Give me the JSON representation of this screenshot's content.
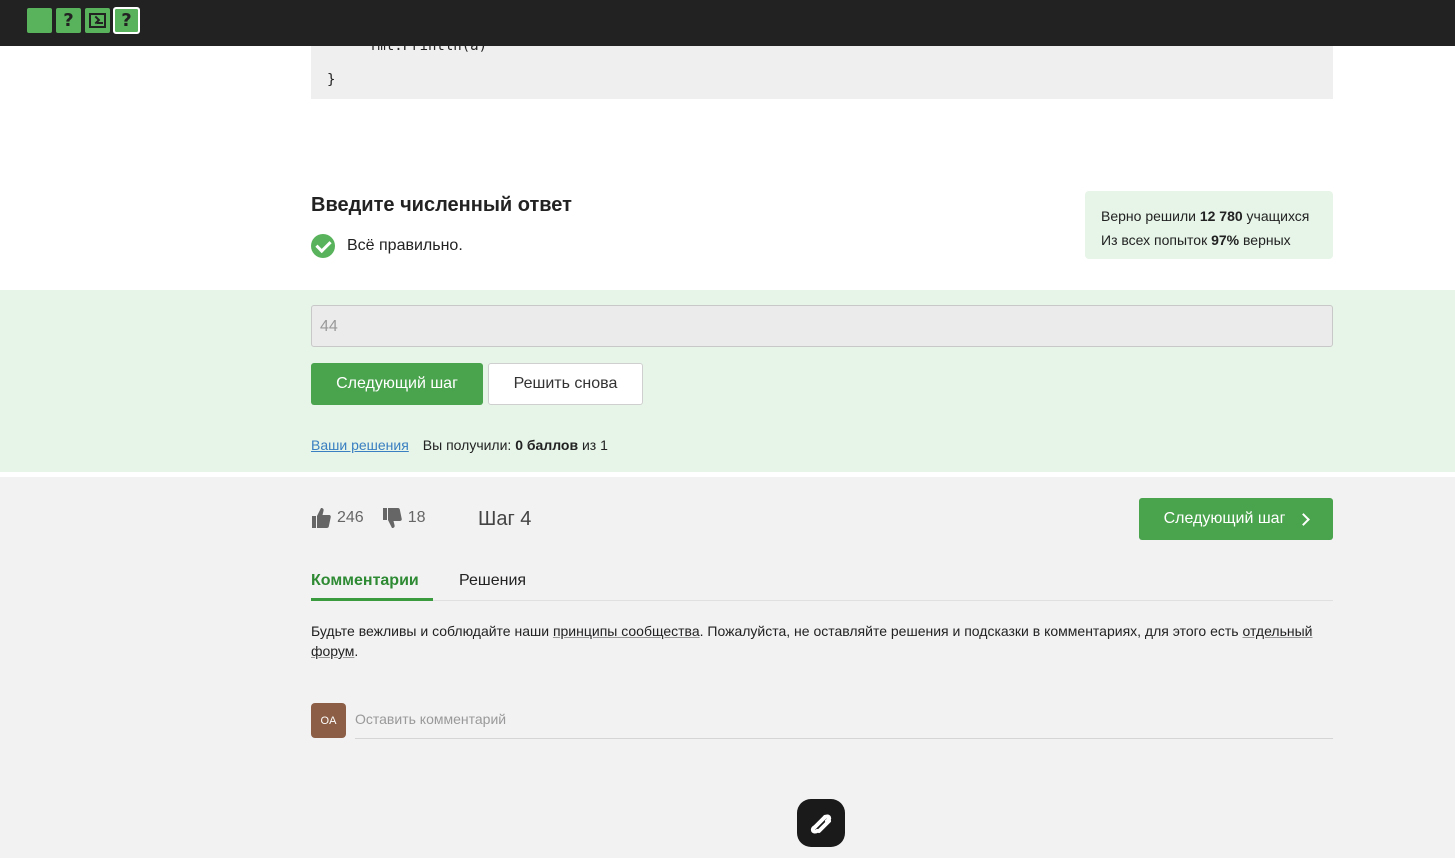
{
  "topbar": {
    "step_icons": [
      {
        "name": "step-icon-text",
        "glyph": ""
      },
      {
        "name": "step-icon-quiz",
        "glyph": "?"
      },
      {
        "name": "step-icon-code",
        "glyph": ""
      },
      {
        "name": "step-icon-quiz-active",
        "glyph": "?"
      }
    ]
  },
  "code": {
    "line1": "fmt.Println(a)",
    "line2": "}"
  },
  "answer": {
    "heading": "Введите численный ответ",
    "status": "Всё правильно.",
    "input_value": "44",
    "next_button": "Следующий шаг",
    "retry_button": "Решить снова",
    "solutions_link": "Ваши решения",
    "score_prefix": "Вы получили:",
    "score_value": "0 баллов",
    "score_suffix": "из 1"
  },
  "stats": {
    "solved_prefix": "Верно решили",
    "solved_count": "12 780",
    "solved_suffix": "учащихся",
    "attempts_prefix": "Из всех попыток",
    "attempts_pct": "97%",
    "attempts_suffix": "верных"
  },
  "footer": {
    "likes": "246",
    "dislikes": "18",
    "step_label": "Шаг 4",
    "next_step_button": "Следующий шаг"
  },
  "tabs": {
    "comments": "Комментарии",
    "solutions": "Решения"
  },
  "rules": {
    "part1": "Будьте вежливы и соблюдайте наши ",
    "link1": "принципы сообщества",
    "part2": ". Пожалуйста, не оставляйте решения и подсказки в комментариях, для этого есть ",
    "link2": "отдельный форум",
    "part3": "."
  },
  "comment": {
    "avatar_initials": "OA",
    "placeholder": "Оставить комментарий"
  },
  "colors": {
    "accent": "#4aa34d",
    "success_bg": "#e6f5e8",
    "topbar": "#222222"
  }
}
